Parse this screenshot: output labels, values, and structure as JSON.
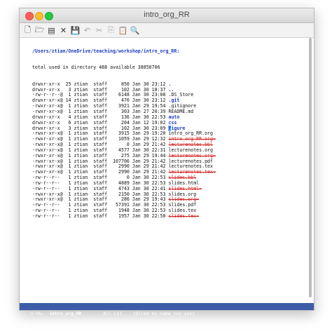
{
  "window": {
    "title": "intro_org_RR"
  },
  "toolbar": {
    "buttons": [
      {
        "name": "new-file-icon",
        "glyph": "🗋",
        "state": "enabled"
      },
      {
        "name": "open-folder-icon",
        "glyph": "🗁",
        "state": "enabled"
      },
      {
        "name": "dired-icon",
        "glyph": "▤",
        "state": "enabled"
      },
      {
        "name": "close-buffer-icon",
        "glyph": "✕",
        "state": "enabled"
      },
      {
        "name": "save-icon",
        "glyph": "💾",
        "state": "disabled"
      },
      {
        "name": "undo-icon",
        "glyph": "↶",
        "state": "disabled"
      },
      {
        "name": "cut-icon",
        "glyph": "✂",
        "state": "disabled"
      },
      {
        "name": "copy-icon",
        "glyph": "⎘",
        "state": "disabled"
      },
      {
        "name": "paste-icon",
        "glyph": "📋",
        "state": "disabled"
      },
      {
        "name": "search-icon",
        "glyph": "🔍",
        "state": "enabled"
      }
    ]
  },
  "dired": {
    "header": "  /Users/ztian/OneDrive/teaching/workshop/intro_org_RR:",
    "total": "  total used in directory 488 available 38850706",
    "rows": [
      {
        "perms": "drwxr-xr-x",
        "links": "25",
        "owner": "ztian",
        "group": "staff",
        "size": "850",
        "date": "Jan 30 23:12",
        "name": ".",
        "kind": "dir"
      },
      {
        "perms": "drwxr-xr-x",
        "links": " 3",
        "owner": "ztian",
        "group": "staff",
        "size": "102",
        "date": "Jan 30 18:37",
        "name": "..",
        "kind": "dir"
      },
      {
        "perms": "-rw-r--r--@",
        "links": " 1",
        "owner": "ztian",
        "group": "staff",
        "size": "6148",
        "date": "Jan 30 23:08",
        "name": ".DS_Store",
        "kind": "file"
      },
      {
        "perms": "drwxr-xr-x@",
        "links": "14",
        "owner": "ztian",
        "group": "staff",
        "size": "476",
        "date": "Jan 30 23:12",
        "name": ".git",
        "kind": "dir"
      },
      {
        "perms": "-rwxr-xr-x@",
        "links": " 1",
        "owner": "ztian",
        "group": "staff",
        "size": "3921",
        "date": "Jan 29 19:54",
        "name": ".gitignore",
        "kind": "file"
      },
      {
        "perms": "-rwxr-xr-x@",
        "links": " 1",
        "owner": "ztian",
        "group": "staff",
        "size": "303",
        "date": "Jan 27 20:39",
        "name": "README.md",
        "kind": "file"
      },
      {
        "perms": "drwxr-xr-x",
        "links": " 4",
        "owner": "ztian",
        "group": "staff",
        "size": "136",
        "date": "Jan 30 22:53",
        "name": "auto",
        "kind": "dir"
      },
      {
        "perms": "drwxr-xr-x",
        "links": " 6",
        "owner": "ztian",
        "group": "staff",
        "size": "204",
        "date": "Jan 12 19:02",
        "name": "css",
        "kind": "dir"
      },
      {
        "perms": "drwxr-xr-x",
        "links": " 3",
        "owner": "ztian",
        "group": "staff",
        "size": "102",
        "date": "Jan 30 23:09",
        "name": "figure",
        "kind": "dir-cursor"
      },
      {
        "perms": "-rwxr-xr-x@",
        "links": " 1",
        "owner": "ztian",
        "group": "staff",
        "size": "3915",
        "date": "Jan 29 19:20",
        "name": "intro_org_RR.org",
        "kind": "file"
      },
      {
        "perms": "-rwxr-xr-x@",
        "links": " 1",
        "owner": "ztian",
        "group": "staff",
        "size": "1059",
        "date": "Jan 29 12:32",
        "name": "intro_org_RR.org~",
        "kind": "ignored"
      },
      {
        "perms": "-rwxr-xr-x@",
        "links": " 1",
        "owner": "ztian",
        "group": "staff",
        "size": "0",
        "date": "Jan 29 21:42",
        "name": "lecturenotes.bbl",
        "kind": "ignored"
      },
      {
        "perms": "-rwxr-xr-x@",
        "links": " 1",
        "owner": "ztian",
        "group": "staff",
        "size": "4577",
        "date": "Jan 30 22:31",
        "name": "lecturenotes.org",
        "kind": "file"
      },
      {
        "perms": "-rwxr-xr-x@",
        "links": " 1",
        "owner": "ztian",
        "group": "staff",
        "size": "275",
        "date": "Jan 29 19:44",
        "name": "lecturenotes.org~",
        "kind": "ignored"
      },
      {
        "perms": "-rwxr-xr-x@",
        "links": " 1",
        "owner": "ztian",
        "group": "staff",
        "size": "107706",
        "date": "Jan 29 21:42",
        "name": "lecturenotes.pdf",
        "kind": "file"
      },
      {
        "perms": "-rwxr-xr-x@",
        "links": " 1",
        "owner": "ztian",
        "group": "staff",
        "size": "2990",
        "date": "Jan 29 21:42",
        "name": "lecturenotes.tex",
        "kind": "file"
      },
      {
        "perms": "-rwxr-xr-x@",
        "links": " 1",
        "owner": "ztian",
        "group": "staff",
        "size": "2990",
        "date": "Jan 29 21:42",
        "name": "lecturenotes.tex~",
        "kind": "ignored"
      },
      {
        "perms": "-rw-r--r--",
        "links": " 1",
        "owner": "ztian",
        "group": "staff",
        "size": "0",
        "date": "Jan 30 22:53",
        "name": "slides.bbl",
        "kind": "ignored"
      },
      {
        "perms": "-rw-r--r--",
        "links": " 1",
        "owner": "ztian",
        "group": "staff",
        "size": "4889",
        "date": "Jan 30 22:53",
        "name": "slides.html",
        "kind": "file"
      },
      {
        "perms": "-rw-r--r--",
        "links": " 1",
        "owner": "ztian",
        "group": "staff",
        "size": "4743",
        "date": "Jan 30 22:41",
        "name": "slides.html~",
        "kind": "ignored"
      },
      {
        "perms": "-rwxr-xr-x@",
        "links": " 1",
        "owner": "ztian",
        "group": "staff",
        "size": "2150",
        "date": "Jan 30 22:53",
        "name": "slides.org",
        "kind": "file"
      },
      {
        "perms": "-rwxr-xr-x@",
        "links": " 1",
        "owner": "ztian",
        "group": "staff",
        "size": "286",
        "date": "Jan 29 19:43",
        "name": "slides.org~",
        "kind": "ignored"
      },
      {
        "perms": "-rw-r--r--",
        "links": " 1",
        "owner": "ztian",
        "group": "staff",
        "size": "57391",
        "date": "Jan 30 22:53",
        "name": "slides.pdf",
        "kind": "file"
      },
      {
        "perms": "-rw-r--r--",
        "links": " 1",
        "owner": "ztian",
        "group": "staff",
        "size": "1948",
        "date": "Jan 30 22:53",
        "name": "slides.tex",
        "kind": "file"
      },
      {
        "perms": "-rw-r--r--",
        "links": " 1",
        "owner": "ztian",
        "group": "staff",
        "size": "1957",
        "date": "Jan 30 22:50",
        "name": "slides.tex~",
        "kind": "ignored"
      }
    ]
  },
  "modeline": {
    "status": "U:%%-",
    "buffer": "intro_org_RR",
    "position": "All L11",
    "mode": "(Dired by name ivy yas)"
  },
  "colors": {
    "directory": "#1e3cc4",
    "ignored_file": "#d02020",
    "modeline_bg": "#3c5ea8",
    "cursor": "#6bb0ff"
  }
}
